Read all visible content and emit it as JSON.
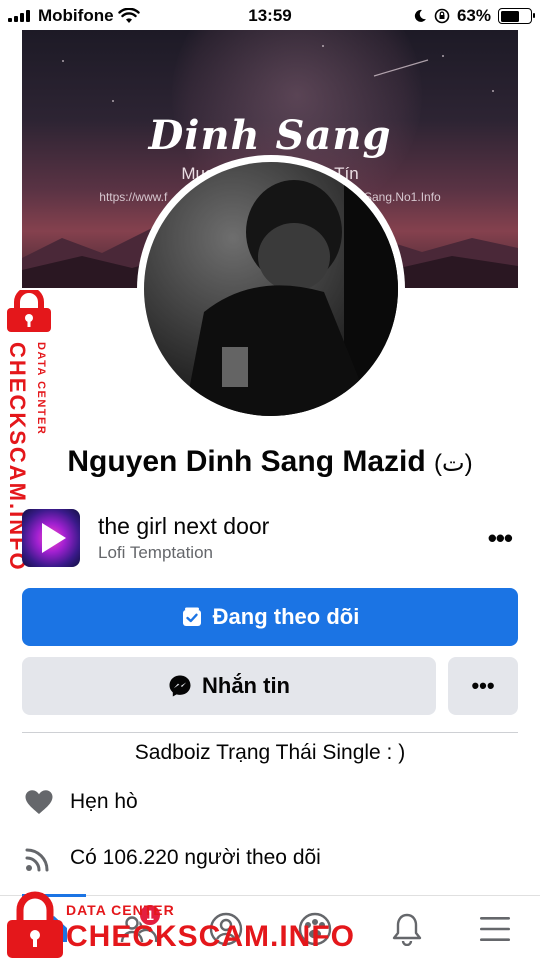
{
  "status_bar": {
    "carrier": "Mobifone",
    "time": "13:59",
    "battery_percent_label": "63%",
    "battery_level": 0.63,
    "icons": [
      "signal-bars-icon",
      "wifi-icon",
      "moon-icon",
      "rotation-lock-icon",
      "battery-icon"
    ]
  },
  "cover": {
    "title": "Dinh Sang",
    "subtitle": "Mua Bán A                         á Rẻ Uy Tín",
    "url_left": "https://www.f",
    "url_right": "Sang.No1.Info"
  },
  "profile": {
    "name": "Nguyen Dinh Sang Mazid",
    "name_suffix": "(ت)"
  },
  "music": {
    "title": "the girl next door",
    "artist": "Lofi Temptation",
    "more_label": "•••"
  },
  "actions": {
    "follow_label": "Đang theo dõi",
    "message_label": "Nhắn tin",
    "more_label": "•••"
  },
  "bio": "Sadboiz Trạng Thái Single : )",
  "details": [
    {
      "icon": "heart-icon",
      "text": "Hẹn hò"
    },
    {
      "icon": "rss-followers-icon",
      "text": "Có 106.220 người theo dõi"
    }
  ],
  "bottom_nav": {
    "items": [
      "home-icon",
      "friends-icon",
      "profile-icon",
      "groups-icon",
      "notifications-icon",
      "menu-icon"
    ],
    "active": "home-icon",
    "friends_badge": "1"
  },
  "watermark": {
    "small": "DATA CENTER",
    "large": "CHECKSCAM.INFO"
  },
  "colors": {
    "accent": "#1b74e4",
    "secondary_button": "#e4e6eb",
    "muted_text": "#65676b",
    "watermark_red": "#e4171b",
    "badge_red": "#e41e3f"
  }
}
